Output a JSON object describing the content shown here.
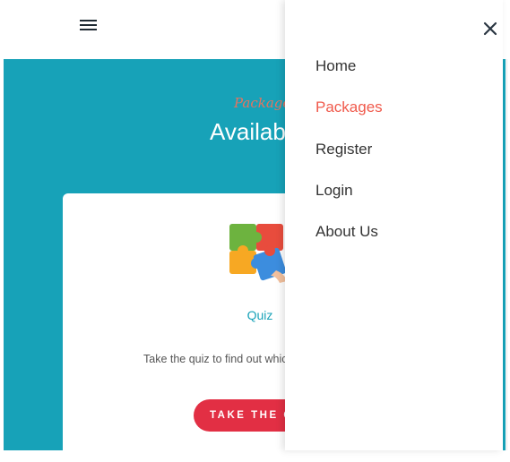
{
  "header": {
    "menu_icon": "hamburger-icon"
  },
  "hero": {
    "eyebrow": "Packages",
    "title": "Available Packages"
  },
  "card": {
    "icon": "puzzle-icon",
    "title": "Quiz",
    "description": "Take the quiz to find out which package is right for you",
    "cta_label": "TAKE THE QUIZ"
  },
  "drawer": {
    "close_icon": "close-icon",
    "items": [
      {
        "label": "Home",
        "active": false
      },
      {
        "label": "Packages",
        "active": true
      },
      {
        "label": "Register",
        "active": false
      },
      {
        "label": "Login",
        "active": false
      },
      {
        "label": "About Us",
        "active": false
      }
    ]
  },
  "colors": {
    "teal": "#17a2b8",
    "accent_red": "#e22f44",
    "active_nav": "#f05a4c"
  }
}
